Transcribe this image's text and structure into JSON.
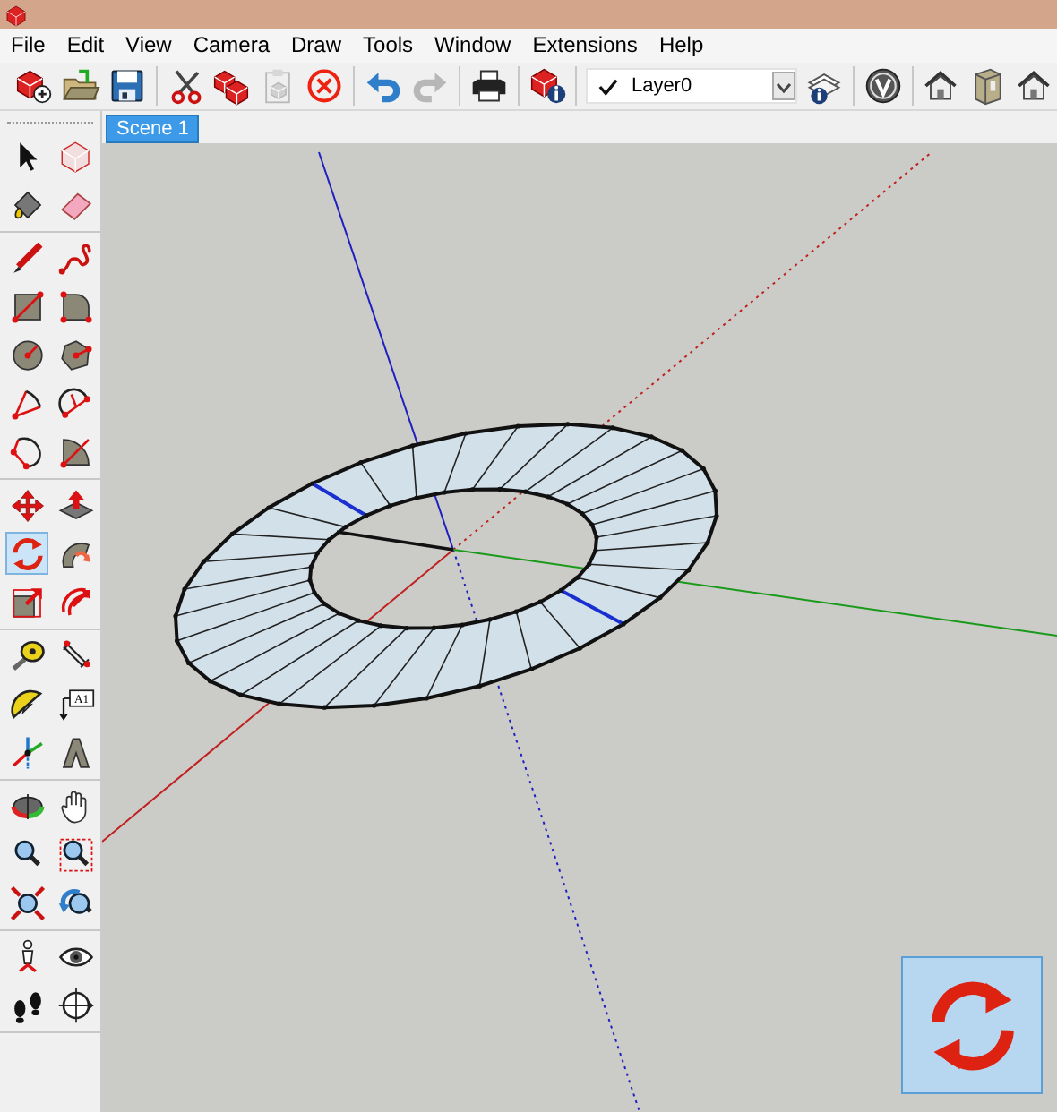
{
  "menu": [
    "File",
    "Edit",
    "View",
    "Camera",
    "Draw",
    "Tools",
    "Window",
    "Extensions",
    "Help"
  ],
  "toolbar": [
    {
      "kind": "new",
      "disabled": false
    },
    {
      "kind": "open",
      "disabled": false
    },
    {
      "kind": "save",
      "disabled": false
    },
    {
      "kind": "separator"
    },
    {
      "kind": "cut",
      "disabled": false
    },
    {
      "kind": "copy",
      "disabled": false
    },
    {
      "kind": "paste",
      "disabled": true
    },
    {
      "kind": "erase",
      "disabled": false
    },
    {
      "kind": "separator"
    },
    {
      "kind": "undo",
      "disabled": false
    },
    {
      "kind": "redo",
      "disabled": true
    },
    {
      "kind": "separator"
    },
    {
      "kind": "print",
      "disabled": false
    },
    {
      "kind": "separator"
    },
    {
      "kind": "info",
      "disabled": false
    },
    {
      "kind": "separator"
    },
    {
      "kind": "layer",
      "checked": true,
      "value": "Layer0"
    },
    {
      "kind": "layers",
      "disabled": false
    },
    {
      "kind": "separator"
    },
    {
      "kind": "vray",
      "disabled": false
    },
    {
      "kind": "separator"
    },
    {
      "kind": "house",
      "disabled": false
    },
    {
      "kind": "box",
      "disabled": false
    },
    {
      "kind": "house",
      "disabled": false
    }
  ],
  "scene_tabs": [
    {
      "label": "Scene 1",
      "selected": true
    }
  ],
  "tool_groups": [
    [
      {
        "kind": "select",
        "selected": false
      },
      {
        "kind": "component",
        "selected": false
      },
      {
        "kind": "paint",
        "selected": false
      },
      {
        "kind": "eraser",
        "selected": false
      }
    ],
    [
      {
        "kind": "pencil",
        "selected": false
      },
      {
        "kind": "freehand",
        "selected": false
      },
      {
        "kind": "rect",
        "selected": false
      },
      {
        "kind": "rotrect",
        "selected": false
      },
      {
        "kind": "circle",
        "selected": false
      },
      {
        "kind": "polygon",
        "selected": false
      },
      {
        "kind": "arc",
        "selected": false
      },
      {
        "kind": "arc2",
        "selected": false
      },
      {
        "kind": "arc3",
        "selected": false
      },
      {
        "kind": "pie",
        "selected": false
      }
    ],
    [
      {
        "kind": "move",
        "selected": false
      },
      {
        "kind": "pushpull",
        "selected": false
      },
      {
        "kind": "rotate",
        "selected": true
      },
      {
        "kind": "followme",
        "selected": false
      },
      {
        "kind": "scale",
        "selected": false
      },
      {
        "kind": "offset",
        "selected": false
      }
    ],
    [
      {
        "kind": "tape",
        "selected": false
      },
      {
        "kind": "dimension",
        "selected": false
      },
      {
        "kind": "protractor",
        "selected": false
      },
      {
        "kind": "text",
        "label": "A1",
        "selected": false
      },
      {
        "kind": "axes",
        "selected": false
      },
      {
        "kind": "text3d",
        "selected": false
      }
    ],
    [
      {
        "kind": "orbit",
        "selected": false
      },
      {
        "kind": "pan",
        "selected": false
      },
      {
        "kind": "zoom",
        "selected": false
      },
      {
        "kind": "zoomwin",
        "selected": false
      },
      {
        "kind": "zoomext",
        "selected": false
      },
      {
        "kind": "previous",
        "selected": false
      }
    ],
    [
      {
        "kind": "camera",
        "selected": false
      },
      {
        "kind": "look",
        "selected": false
      },
      {
        "kind": "walk",
        "selected": false
      },
      {
        "kind": "section",
        "selected": false
      }
    ]
  ],
  "overlay_button": {
    "kind": "rotate",
    "selected": true
  }
}
